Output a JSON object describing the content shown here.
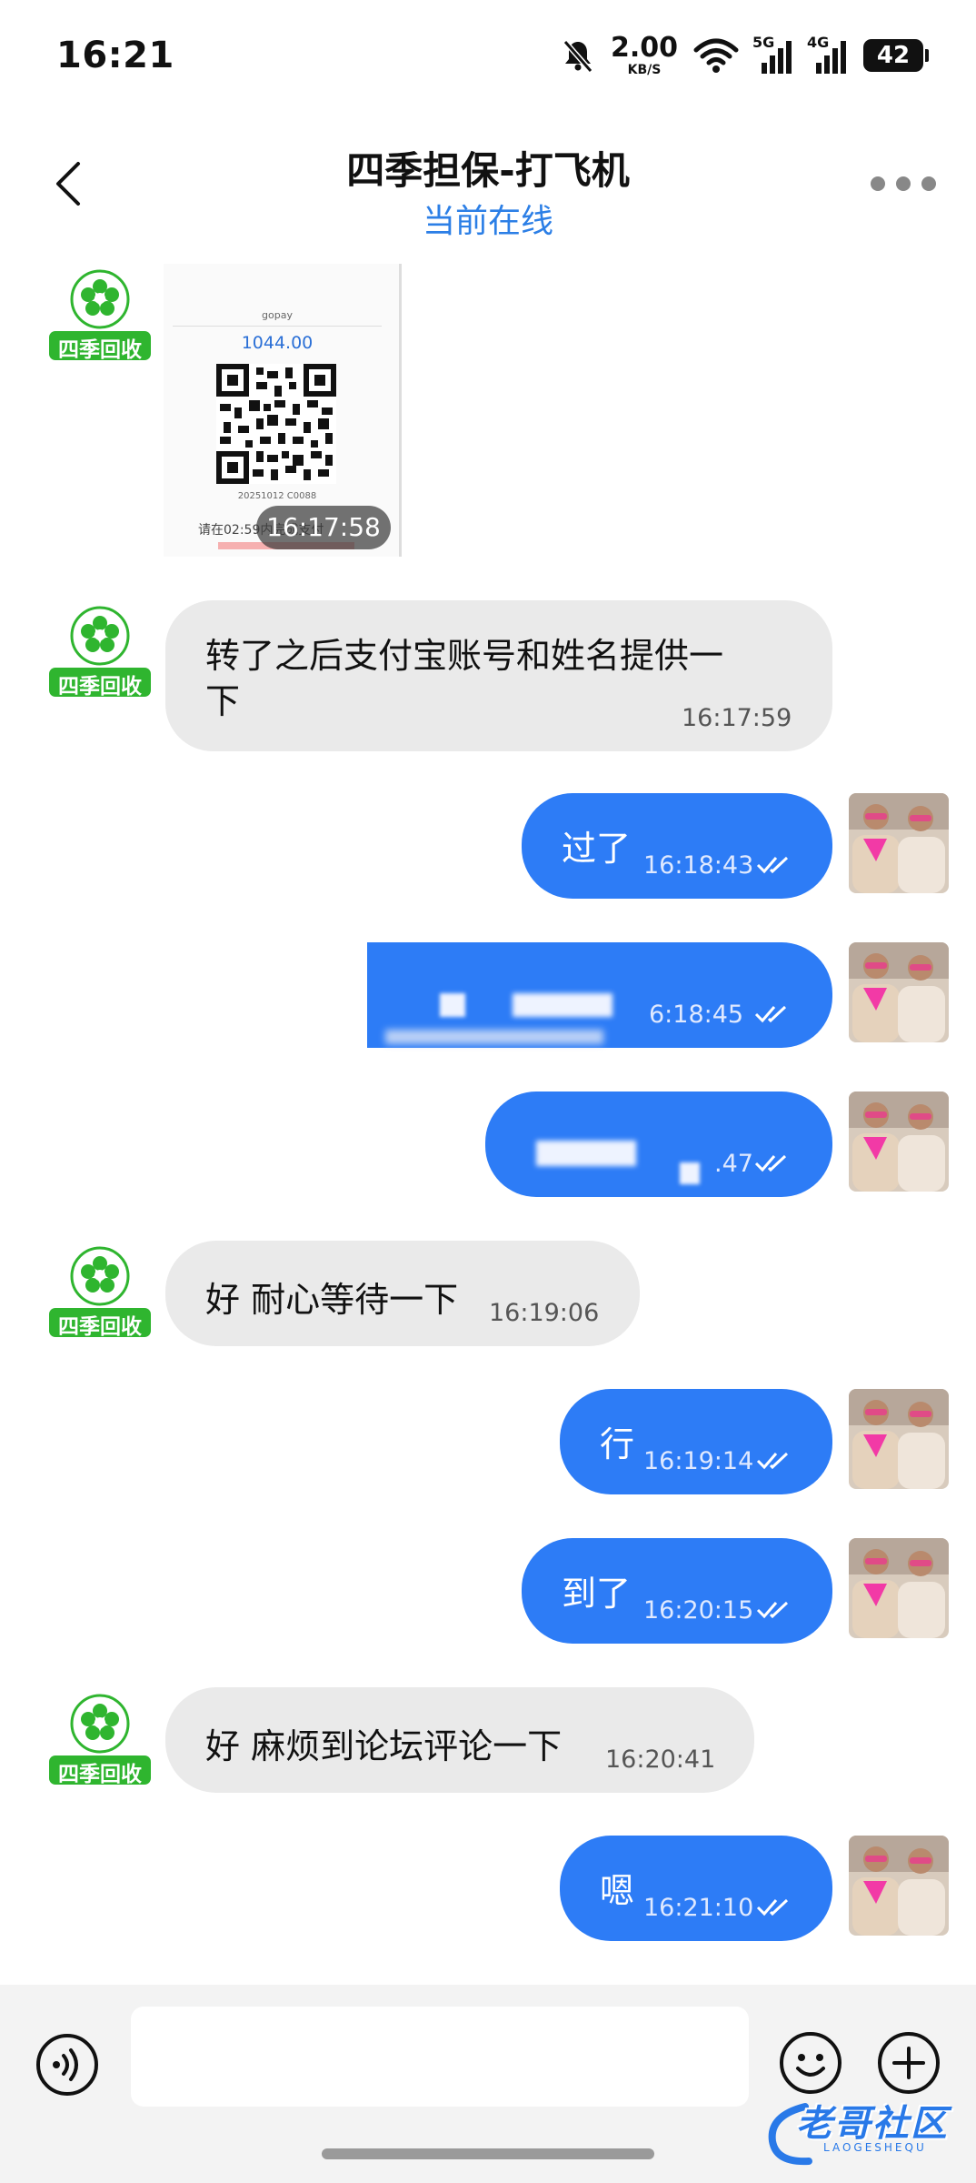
{
  "status_bar": {
    "time": "16:21",
    "net_speed_value": "2.00",
    "net_speed_unit": "KB/S",
    "signal_1_label": "5G",
    "signal_2_label": "4G",
    "battery": "42"
  },
  "header": {
    "title": "四季担保-打飞机",
    "status": "当前在线"
  },
  "contact_avatar_label": "四季回收",
  "messages": [
    {
      "dir": "in",
      "type": "image",
      "time": "16:17:58",
      "image": {
        "brand": "gopay",
        "amount": "1044.00",
        "ref": "20251012 C0088",
        "notice": "请在02:59内完成支付"
      }
    },
    {
      "dir": "in",
      "text_line1": "转了之后支付宝账号和姓名提供一",
      "text_line2": "下",
      "time": "16:17:59"
    },
    {
      "dir": "out",
      "text": "过了",
      "time": "16:18:43"
    },
    {
      "dir": "out",
      "text": "",
      "time": "6:18:45"
    },
    {
      "dir": "out",
      "text": "",
      "time": ".47"
    },
    {
      "dir": "in",
      "text": "好 耐心等待一下",
      "time": "16:19:06"
    },
    {
      "dir": "out",
      "text": "行",
      "time": "16:19:14"
    },
    {
      "dir": "out",
      "text": "到了",
      "time": "16:20:15"
    },
    {
      "dir": "in",
      "text": "好 麻烦到论坛评论一下",
      "time": "16:20:41"
    },
    {
      "dir": "out",
      "text": "嗯",
      "time": "16:21:10"
    }
  ],
  "watermark": {
    "text": "老哥社区",
    "sub": "LAOGESHEQU"
  },
  "colors": {
    "accent": "#2d7cf6",
    "incoming_bubble": "#eaeaea",
    "status_blue": "#2c7fe6",
    "contact_green": "#2fb52f"
  }
}
